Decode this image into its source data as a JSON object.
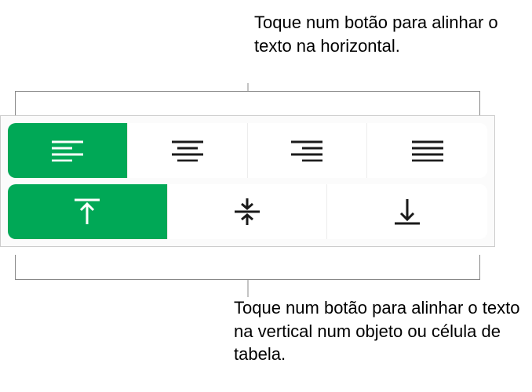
{
  "callouts": {
    "top": "Toque num botão para alinhar o texto na horizontal.",
    "bottom": "Toque num botão para alinhar o texto na vertical num objeto ou célula de tabela."
  },
  "alignment": {
    "horizontal": {
      "selected": "left",
      "options": [
        "left",
        "center",
        "right",
        "justify"
      ],
      "labels": {
        "left": "align-left",
        "center": "align-center",
        "right": "align-right",
        "justify": "align-justify"
      }
    },
    "vertical": {
      "selected": "top",
      "options": [
        "top",
        "middle",
        "bottom"
      ],
      "labels": {
        "top": "align-top",
        "middle": "align-middle",
        "bottom": "align-bottom"
      }
    }
  },
  "colors": {
    "accent": "#00a856"
  }
}
